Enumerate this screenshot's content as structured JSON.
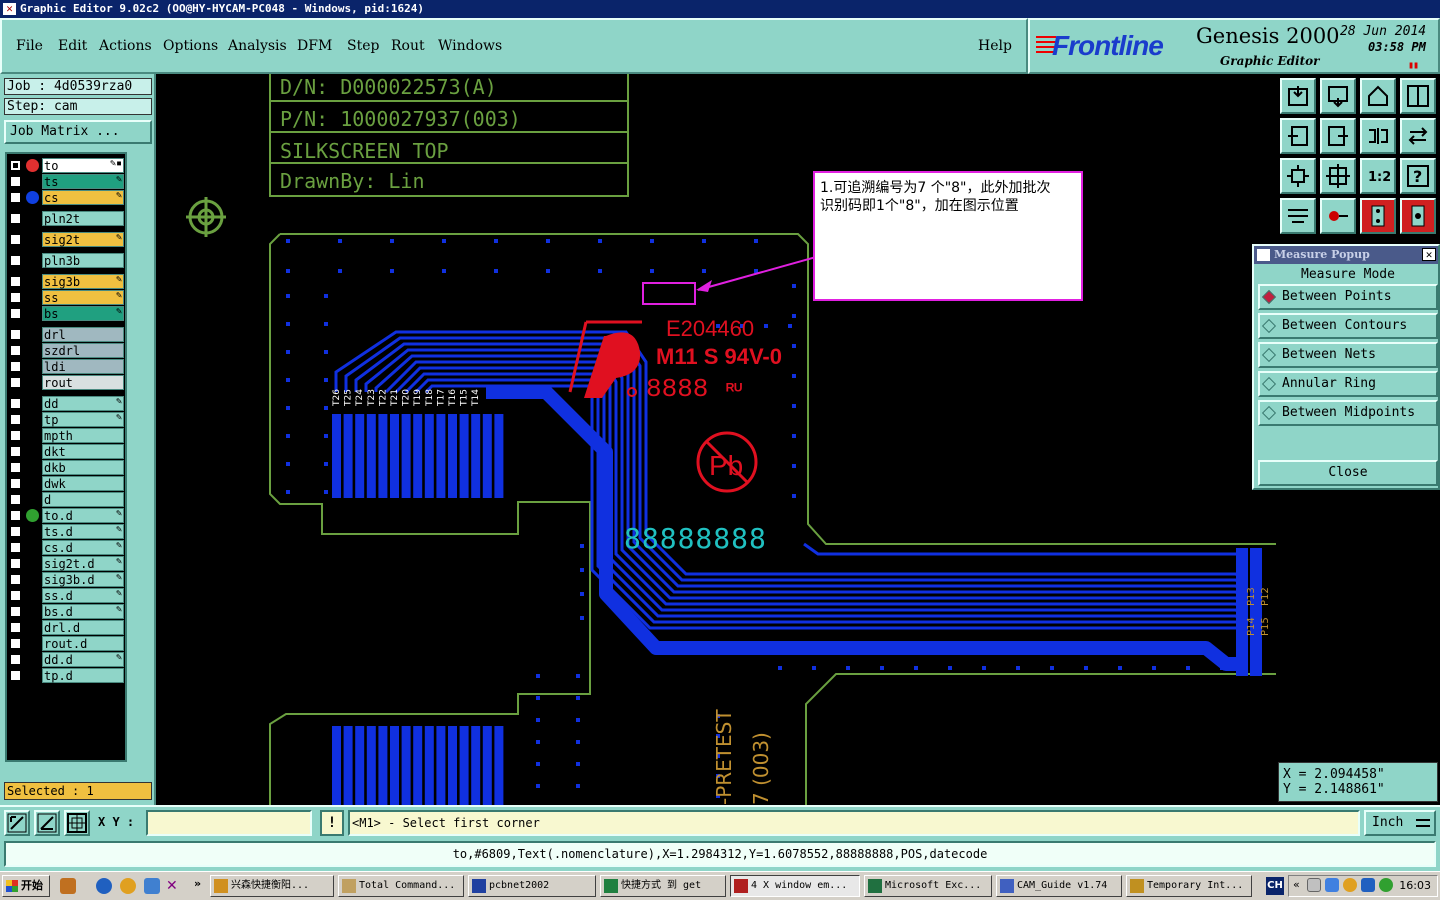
{
  "window": {
    "title": "Graphic Editor 9.02c2  (OO@HY-HYCAM-PC048 - Windows, pid:1624)"
  },
  "menu": {
    "items": [
      {
        "label": "File"
      },
      {
        "label": "Edit"
      },
      {
        "label": "Actions"
      },
      {
        "label": "Options"
      },
      {
        "label": "Analysis"
      },
      {
        "label": "DFM"
      },
      {
        "label": "Step"
      },
      {
        "label": "Rout"
      },
      {
        "label": "Windows"
      }
    ],
    "help": "Help"
  },
  "brand": {
    "logo": "Frontline",
    "product": "Genesis 2000",
    "subtitle": "Graphic Editor",
    "date": "28 Jun 2014",
    "time": "03:58 PM"
  },
  "job": {
    "job_label": "Job : 4d0539rza0",
    "step_label": "Step: cam",
    "matrix_button": "Job Matrix ..."
  },
  "layers": [
    {
      "name": "to",
      "color": "#ffffff",
      "checked": true,
      "dot": "#e03030",
      "flag": "✎▪"
    },
    {
      "name": "ts",
      "color": "#20a080",
      "checked": false,
      "dot": "",
      "flag": "✎"
    },
    {
      "name": "cs",
      "color": "#f0c040",
      "checked": false,
      "dot": "#1040e0",
      "flag": "✎"
    },
    {
      "name": "pln2t",
      "color": "#8fd5c8",
      "checked": false,
      "dot": "",
      "flag": ""
    },
    {
      "name": "sig2t",
      "color": "#f0c040",
      "checked": false,
      "dot": "",
      "flag": "✎"
    },
    {
      "name": "pln3b",
      "color": "#8fd5c8",
      "checked": false,
      "dot": "",
      "flag": ""
    },
    {
      "name": "sig3b",
      "color": "#f0c040",
      "checked": false,
      "dot": "",
      "flag": "✎"
    },
    {
      "name": "ss",
      "color": "#f0c040",
      "checked": false,
      "dot": "",
      "flag": "✎"
    },
    {
      "name": "bs",
      "color": "#20a080",
      "checked": false,
      "dot": "",
      "flag": "✎"
    },
    {
      "name": "drl",
      "color": "#a0b8c0",
      "checked": false,
      "dot": "",
      "flag": ""
    },
    {
      "name": "szdrl",
      "color": "#a0b8c0",
      "checked": false,
      "dot": "",
      "flag": ""
    },
    {
      "name": "ldi",
      "color": "#a0b8c0",
      "checked": false,
      "dot": "",
      "flag": ""
    },
    {
      "name": "rout",
      "color": "#d8e0e0",
      "checked": false,
      "dot": "",
      "flag": ""
    },
    {
      "name": "dd",
      "color": "#8fd5c8",
      "checked": false,
      "dot": "",
      "flag": "✎"
    },
    {
      "name": "tp",
      "color": "#8fd5c8",
      "checked": false,
      "dot": "",
      "flag": "✎"
    },
    {
      "name": "mpth",
      "color": "#8fd5c8",
      "checked": false,
      "dot": "",
      "flag": ""
    },
    {
      "name": "dkt",
      "color": "#8fd5c8",
      "checked": false,
      "dot": "",
      "flag": ""
    },
    {
      "name": "dkb",
      "color": "#8fd5c8",
      "checked": false,
      "dot": "",
      "flag": ""
    },
    {
      "name": "dwk",
      "color": "#8fd5c8",
      "checked": false,
      "dot": "",
      "flag": ""
    },
    {
      "name": "d",
      "color": "#8fd5c8",
      "checked": false,
      "dot": "",
      "flag": ""
    },
    {
      "name": "to.d",
      "color": "#8fd5c8",
      "checked": false,
      "dot": "#30a030",
      "flag": "✎"
    },
    {
      "name": "ts.d",
      "color": "#8fd5c8",
      "checked": false,
      "dot": "",
      "flag": "✎"
    },
    {
      "name": "cs.d",
      "color": "#8fd5c8",
      "checked": false,
      "dot": "",
      "flag": "✎"
    },
    {
      "name": "sig2t.d",
      "color": "#8fd5c8",
      "checked": false,
      "dot": "",
      "flag": "✎"
    },
    {
      "name": "sig3b.d",
      "color": "#8fd5c8",
      "checked": false,
      "dot": "",
      "flag": "✎"
    },
    {
      "name": "ss.d",
      "color": "#8fd5c8",
      "checked": false,
      "dot": "",
      "flag": "✎"
    },
    {
      "name": "bs.d",
      "color": "#8fd5c8",
      "checked": false,
      "dot": "",
      "flag": "✎"
    },
    {
      "name": "drl.d",
      "color": "#8fd5c8",
      "checked": false,
      "dot": "",
      "flag": ""
    },
    {
      "name": "rout.d",
      "color": "#8fd5c8",
      "checked": false,
      "dot": "",
      "flag": ""
    },
    {
      "name": "dd.d",
      "color": "#8fd5c8",
      "checked": false,
      "dot": "",
      "flag": "✎"
    },
    {
      "name": "tp.d",
      "color": "#8fd5c8",
      "checked": false,
      "dot": "",
      "flag": ""
    }
  ],
  "selected": "Selected : 1",
  "canvas": {
    "title_block": [
      "D/N:  D000022573(A)",
      "P/N:  1000027937(003)",
      "SILKSCREEN TOP",
      "DrawnBy: Lin"
    ],
    "annotation": [
      "1.可追溯编号为7 个\"8\"，此外加批次",
      "识别码即1个\"8\"，加在图示位置"
    ],
    "ul_text": [
      "E204460",
      "M11 S 94V-0",
      "8888"
    ],
    "pb_text": "Pb",
    "serial_text": "88888888",
    "left_pin_labels": [
      "T26",
      "T25",
      "T24",
      "T23",
      "T22",
      "T21",
      "T20",
      "T19",
      "T18",
      "T17",
      "T16",
      "T15",
      "T14"
    ],
    "right_pin_labels": [
      "P13",
      "P12",
      "P14",
      "P15"
    ],
    "bottom_text": [
      "-PRETEST",
      "7 (003)"
    ]
  },
  "measure_popup": {
    "title": "Measure Popup",
    "mode_label": "Measure Mode",
    "options": [
      {
        "label": "Between Points",
        "selected": true
      },
      {
        "label": "Between Contours",
        "selected": false
      },
      {
        "label": "Between Nets",
        "selected": false
      },
      {
        "label": "Annular Ring",
        "selected": false
      },
      {
        "label": "Between Midpoints",
        "selected": false
      }
    ],
    "close": "Close"
  },
  "coords": {
    "x": "X = 2.094458\"",
    "y": "Y = 2.148861\""
  },
  "bottom": {
    "xy_label": "X Y :",
    "xy_value": "",
    "prompt": "<M1> - Select first corner",
    "units": "Inch",
    "status": "to,#6809,Text(.nomenclature),X=1.2984312,Y=1.6078552,88888888,POS,datecode"
  },
  "taskbar": {
    "start": "开始",
    "tasks": [
      {
        "label": "兴森快捷衡阳...",
        "icon": "#d09020",
        "active": false
      },
      {
        "label": "Total Command...",
        "icon": "#c0a060",
        "active": false
      },
      {
        "label": "pcbnet2002",
        "icon": "#2040a0",
        "active": false
      },
      {
        "label": "快捷方式 到 get",
        "icon": "#208040",
        "active": false
      },
      {
        "label": "4 X window em...",
        "icon": "#b02020",
        "active": true
      },
      {
        "label": "Microsoft Exc...",
        "icon": "#207040",
        "active": false
      },
      {
        "label": "CAM_Guide v1.74",
        "icon": "#4060c0",
        "active": false
      },
      {
        "label": "Temporary Int...",
        "icon": "#c09020",
        "active": false
      }
    ],
    "lang": "CH",
    "clock": "16:03"
  },
  "colors": {
    "panel": "#8fd5c8",
    "silk": "#6aa040",
    "copper": "#1030e0",
    "mark": "#e01020",
    "serial": "#20c0c0",
    "annot": "#e020e0"
  }
}
